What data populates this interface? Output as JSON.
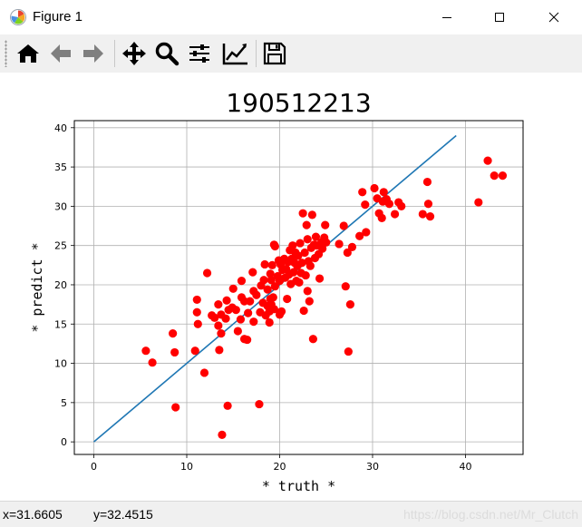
{
  "window": {
    "title": "Figure 1",
    "controls": {
      "minimize": "minimize",
      "maximize": "maximize",
      "close": "close"
    }
  },
  "toolbar": {
    "buttons": [
      {
        "icon": "home-icon"
      },
      {
        "icon": "back-arrow-icon"
      },
      {
        "icon": "forward-arrow-icon"
      },
      {
        "icon": "pan-move-icon"
      },
      {
        "icon": "zoom-magnifier-icon"
      },
      {
        "icon": "subplots-sliders-icon"
      },
      {
        "icon": "edit-curve-icon"
      },
      {
        "icon": "save-floppy-icon"
      }
    ]
  },
  "status": {
    "x_readout": "x=31.6605",
    "y_readout": "y=32.4515",
    "watermark": "https://blog.csdn.net/Mr_Clutch"
  },
  "colors": {
    "scatter": "#ff0000",
    "line": "#1f77b4",
    "grid": "#b0b0b0",
    "toolbar_bg": "#f0f0f0"
  },
  "chart_data": {
    "type": "scatter",
    "title": "190512213",
    "xlabel": "* truth *",
    "ylabel": "* predict *",
    "xlim": [
      -2.1,
      46.2
    ],
    "ylim": [
      -1.6,
      40.9
    ],
    "xticks": [
      0,
      10,
      20,
      30,
      40
    ],
    "yticks": [
      0,
      5,
      10,
      15,
      20,
      25,
      30,
      35,
      40
    ],
    "grid": true,
    "line": {
      "x": [
        0,
        39
      ],
      "y": [
        0,
        39
      ]
    },
    "points": [
      [
        5.6,
        11.6
      ],
      [
        6.3,
        10.1
      ],
      [
        8.5,
        13.8
      ],
      [
        8.7,
        11.4
      ],
      [
        8.8,
        4.4
      ],
      [
        10.9,
        11.6
      ],
      [
        11.1,
        18.1
      ],
      [
        11.1,
        16.5
      ],
      [
        11.2,
        15.0
      ],
      [
        11.9,
        8.8
      ],
      [
        12.2,
        21.5
      ],
      [
        12.7,
        16.1
      ],
      [
        13.0,
        15.8
      ],
      [
        13.4,
        17.5
      ],
      [
        13.4,
        14.8
      ],
      [
        13.5,
        11.7
      ],
      [
        13.7,
        13.8
      ],
      [
        13.7,
        16.2
      ],
      [
        13.8,
        0.9
      ],
      [
        14.2,
        15.7
      ],
      [
        14.3,
        18.0
      ],
      [
        14.4,
        4.6
      ],
      [
        14.5,
        16.8
      ],
      [
        14.9,
        17.1
      ],
      [
        15.0,
        19.5
      ],
      [
        15.3,
        16.8
      ],
      [
        15.5,
        14.1
      ],
      [
        15.8,
        15.6
      ],
      [
        15.9,
        18.4
      ],
      [
        15.9,
        20.5
      ],
      [
        16.2,
        13.1
      ],
      [
        16.2,
        17.9
      ],
      [
        16.5,
        13.0
      ],
      [
        16.6,
        16.4
      ],
      [
        16.8,
        17.9
      ],
      [
        17.1,
        21.6
      ],
      [
        17.2,
        15.3
      ],
      [
        17.2,
        19.2
      ],
      [
        17.5,
        18.7
      ],
      [
        17.8,
        4.8
      ],
      [
        17.9,
        16.5
      ],
      [
        18.0,
        19.9
      ],
      [
        18.2,
        17.7
      ],
      [
        18.3,
        20.6
      ],
      [
        18.4,
        22.6
      ],
      [
        18.5,
        16.1
      ],
      [
        18.7,
        17.3
      ],
      [
        18.7,
        19.4
      ],
      [
        18.9,
        15.2
      ],
      [
        18.9,
        16.6
      ],
      [
        19.0,
        18.2
      ],
      [
        19.0,
        21.4
      ],
      [
        19.1,
        17.5
      ],
      [
        19.1,
        20.6
      ],
      [
        19.2,
        22.5
      ],
      [
        19.3,
        18.4
      ],
      [
        19.4,
        16.9
      ],
      [
        19.4,
        25.1
      ],
      [
        19.5,
        19.8
      ],
      [
        19.5,
        24.9
      ],
      [
        19.8,
        21.1
      ],
      [
        19.9,
        23.1
      ],
      [
        20.0,
        16.2
      ],
      [
        20.0,
        20.5
      ],
      [
        20.1,
        22.6
      ],
      [
        20.2,
        16.6
      ],
      [
        20.3,
        21.9
      ],
      [
        20.5,
        23.3
      ],
      [
        20.6,
        20.9
      ],
      [
        20.7,
        22.0
      ],
      [
        20.8,
        18.2
      ],
      [
        20.9,
        22.9
      ],
      [
        21.0,
        21.3
      ],
      [
        21.1,
        24.4
      ],
      [
        21.2,
        20.1
      ],
      [
        21.3,
        23.3
      ],
      [
        21.4,
        25.0
      ],
      [
        21.5,
        21.6
      ],
      [
        21.6,
        22.8
      ],
      [
        21.7,
        24.1
      ],
      [
        21.8,
        20.5
      ],
      [
        21.9,
        22.4
      ],
      [
        22.0,
        23.7
      ],
      [
        22.1,
        20.3
      ],
      [
        22.2,
        25.3
      ],
      [
        22.3,
        21.5
      ],
      [
        22.4,
        22.8
      ],
      [
        22.5,
        29.1
      ],
      [
        22.6,
        16.7
      ],
      [
        22.7,
        24.1
      ],
      [
        22.8,
        21.2
      ],
      [
        22.9,
        27.6
      ],
      [
        23.0,
        19.2
      ],
      [
        23.0,
        25.8
      ],
      [
        23.1,
        23.0
      ],
      [
        23.2,
        17.9
      ],
      [
        23.3,
        22.4
      ],
      [
        23.4,
        24.7
      ],
      [
        23.5,
        28.9
      ],
      [
        23.6,
        13.1
      ],
      [
        23.7,
        25.1
      ],
      [
        23.8,
        23.4
      ],
      [
        23.9,
        26.1
      ],
      [
        24.0,
        25.0
      ],
      [
        24.2,
        23.9
      ],
      [
        24.3,
        20.8
      ],
      [
        24.5,
        25.4
      ],
      [
        24.6,
        24.6
      ],
      [
        24.8,
        26.0
      ],
      [
        24.9,
        27.6
      ],
      [
        25.0,
        25.4
      ],
      [
        26.4,
        25.2
      ],
      [
        26.9,
        27.5
      ],
      [
        27.1,
        19.8
      ],
      [
        27.3,
        24.1
      ],
      [
        27.4,
        11.5
      ],
      [
        27.6,
        17.5
      ],
      [
        27.8,
        24.8
      ],
      [
        28.6,
        26.2
      ],
      [
        28.9,
        31.8
      ],
      [
        29.2,
        30.2
      ],
      [
        29.3,
        26.7
      ],
      [
        30.2,
        32.3
      ],
      [
        30.5,
        31.0
      ],
      [
        30.7,
        29.1
      ],
      [
        31.0,
        28.5
      ],
      [
        31.1,
        30.6
      ],
      [
        31.2,
        31.8
      ],
      [
        31.5,
        30.9
      ],
      [
        31.8,
        30.3
      ],
      [
        32.4,
        29.0
      ],
      [
        32.8,
        30.5
      ],
      [
        33.1,
        30.0
      ],
      [
        35.4,
        29.0
      ],
      [
        35.9,
        33.1
      ],
      [
        36.0,
        30.3
      ],
      [
        36.2,
        28.7
      ],
      [
        41.4,
        30.5
      ],
      [
        42.4,
        35.8
      ],
      [
        43.1,
        33.9
      ],
      [
        44.0,
        33.9
      ]
    ]
  }
}
